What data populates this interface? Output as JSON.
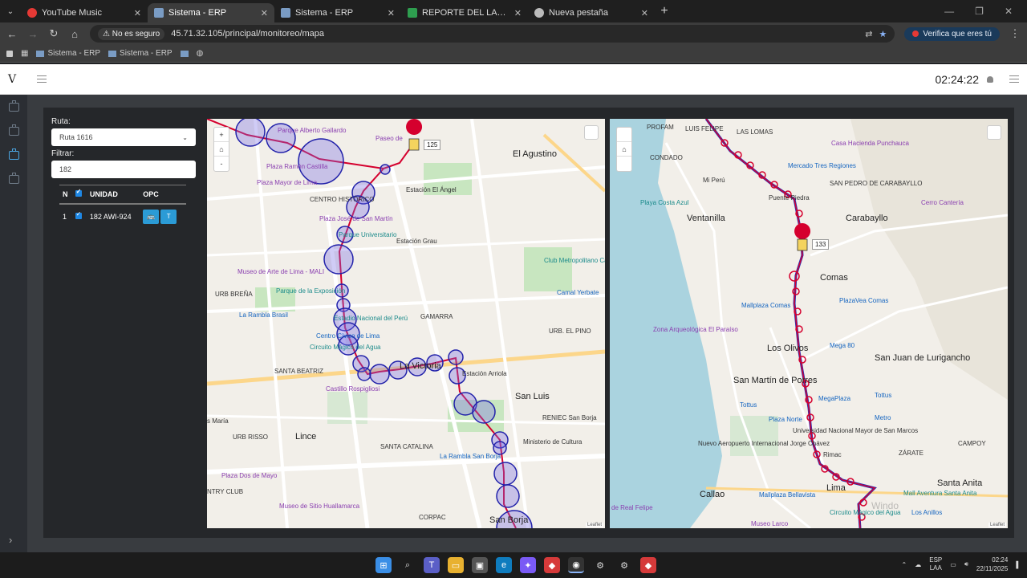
{
  "browser": {
    "tabs": [
      {
        "title": "YouTube Music",
        "icon_color": "#e53935",
        "active": false
      },
      {
        "title": "Sistema - ERP",
        "icon_color": "#7a9cc4",
        "active": true
      },
      {
        "title": "Sistema - ERP",
        "icon_color": "#7a9cc4",
        "active": false
      },
      {
        "title": "REPORTE DEL LADO A VIPUSA",
        "icon_color": "#2e9e4f",
        "active": false
      },
      {
        "title": "Nueva pestaña",
        "icon_color": "#bbbbbb",
        "active": false
      }
    ],
    "security_label": "No es seguro",
    "url": "45.71.32.105/principal/monitoreo/mapa",
    "verify_chip": "Verifica que eres tú",
    "bookmarks": [
      "Sistema - ERP",
      "Sistema - ERP"
    ]
  },
  "app": {
    "logo": "V",
    "clock": "02:24:22"
  },
  "controls": {
    "ruta_label": "Ruta:",
    "ruta_value": "Ruta 1616",
    "filtrar_label": "Filtrar:",
    "filtrar_value": "182",
    "table_headers": {
      "n": "N",
      "unidad": "UNIDAD",
      "opc": "OPC"
    },
    "rows": [
      {
        "n": "1",
        "unidad": "182 AWI-924",
        "btn2": "T"
      }
    ]
  },
  "map_left": {
    "zoom_in": "+",
    "zoom_home": "⌂",
    "zoom_out": "-",
    "attribution": "Leaflet",
    "bus_label": "125",
    "labels": {
      "agustino": "El Agustino",
      "alberto_gallardo": "Parque Alberto Gallardo",
      "paseo": "Paseo de",
      "ramon_castilla": "Plaza Ramón Castilla",
      "plaza_mayor": "Plaza Mayor de Lima",
      "centro": "CENTRO HISTÓRICO",
      "jose_martin": "Plaza José de San Martín",
      "estacion_angel": "Estación El Ángel",
      "estacion_grau": "Estación Grau",
      "parque_univ": "Parque Universitario",
      "museo_arte": "Museo de Arte de Lima - MALI",
      "urb_brena": "URB BREÑA",
      "parque_expo": "Parque de la Exposición",
      "rambla_brasil": "La Rambla Brasil",
      "centro_civico": "Centro Cívico de Lima",
      "estadio": "Estadio Nacional del Perú",
      "circuito": "Circuito Mágico del Agua",
      "gamarra": "GAMARRA",
      "la_victoria": "La Victoria",
      "santa_beatriz": "SANTA BEATRIZ",
      "castillo": "Castillo Rospigliosi",
      "estacion_arriola": "Estación Arriola",
      "san_luis": "San Luis",
      "club_metro": "Club Metropolitano Cahuide",
      "camal": "Camal Yerbate",
      "urb_pino": "URB. EL PINO",
      "reniec": "RENIEC San Borja",
      "ministerio": "Ministerio de Cultura",
      "rambla_borja": "La Rambla San Borja",
      "urb_risso": "URB RISSO",
      "lince": "Lince",
      "santa_catalina": "SANTA CATALINA",
      "dos_mayo": "Plaza Dos de Mayo",
      "san_borja": "San Borja",
      "corpac": "CORPAC",
      "museo_sitio": "Museo de Sitio Huallamarca",
      "s_maria": "s María",
      "ntry_club": "NTRY CLUB"
    }
  },
  "map_right": {
    "zoom_home": "⌂",
    "attribution": "Leaflet",
    "bus_label": "133",
    "watermark": "Windo",
    "labels": {
      "profam": "PROFAM",
      "luis_felipe": "LUIS FELIPE",
      "las_lomas": "LAS LOMAS",
      "casa_hacienda": "Casa Hacienda Punchauca",
      "condado": "CONDADO",
      "mercado": "Mercado Tres Regiones",
      "san_pedro": "SAN PEDRO DE CARABAYLLO",
      "mi_peru": "Mi Perú",
      "puente_piedra": "Puente Piedra",
      "playa": "Playa Costa Azul",
      "ventanilla": "Ventanilla",
      "carabayllo": "Carabayllo",
      "cerro_canteria": "Cerro Cantería",
      "comas": "Comas",
      "plazavea_comas": "PlazaVea Comas",
      "mallplaza_comas": "Mallplaza Comas",
      "zona_arq": "Zona Arqueológica El Paraíso",
      "los_olivos": "Los Olivos",
      "mega80": "Mega 80",
      "sjl": "San Juan de Lurigancho",
      "smp": "San Martín de Porres",
      "tottus": "Tottus",
      "megaplaza": "MegaPlaza",
      "plaza_norte": "Plaza Norte",
      "metro": "Metro",
      "aeropuerto": "Nuevo Aeropuerto Internacional Jorge Chávez",
      "universidad": "Universidad Nacional Mayor de San Marcos",
      "rimac": "Rimac",
      "zarate": "ZÁRATE",
      "campoy": "CAMPOY",
      "callao": "Callao",
      "mallplaza_bellavista": "Mallplaza Bellavista",
      "lima": "Lima",
      "santa_anita": "Santa Anita",
      "mall_aventura": "Mall Aventura Santa Anita",
      "real_felipe": "de Real Felipe",
      "museo_larco": "Museo Larco",
      "circuito": "Circuito Mágico del Agua",
      "la_molina": "Los Anillos"
    }
  },
  "taskbar": {
    "lang": "ESP",
    "lang2": "LAA",
    "time": "02:24",
    "date": "22/11/2025"
  }
}
